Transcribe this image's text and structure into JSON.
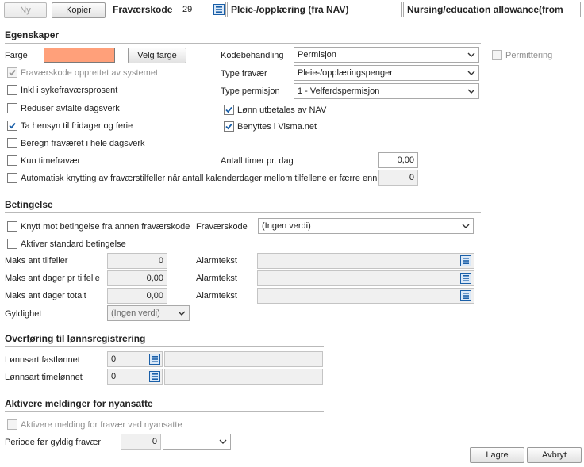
{
  "toolbar": {
    "new_label": "Ny",
    "copy_label": "Kopier",
    "code_label": "Fraværskode",
    "code_value": "29",
    "name_no": "Pleie-/opplæring (fra NAV)",
    "name_en": "Nursing/education allowance(from"
  },
  "properties": {
    "heading": "Egenskaper",
    "color_label": "Farge",
    "color_value": "#FFA07A",
    "choose_color_label": "Velg farge",
    "system_created_label": "Fraværskode opprettet av systemet",
    "incl_sick_label": "Inkl i sykefraværsprosent",
    "reduce_label": "Reduser avtalte dagsverk",
    "holidays_label": "Ta hensyn til fridager og ferie",
    "whole_day_label": "Beregn fraværet i hele dagsverk",
    "hourly_only_label": "Kun timefravær",
    "auto_link_label": "Automatisk knytting av fraværstilfeller når antall kalenderdager mellom tilfellene er færre enn",
    "auto_link_value": "0",
    "code_handling_label": "Kodebehandling",
    "code_handling_value": "Permisjon",
    "permittering_label": "Permittering",
    "absence_type_label": "Type fravær",
    "absence_type_value": "Pleie-/opplæringspenger",
    "leave_type_label": "Type permisjon",
    "leave_type_value": "1 - Velferdspermisjon",
    "nav_pay_label": "Lønn utbetales av NAV",
    "visma_label": "Benyttes i Visma.net",
    "hours_per_day_label": "Antall timer pr. dag",
    "hours_per_day_value": "0,00"
  },
  "conditions": {
    "heading": "Betingelse",
    "link_condition_label": "Knytt mot betingelse fra annen fraværskode",
    "code_label": "Fraværskode",
    "code_value": "(Ingen verdi)",
    "activate_std_label": "Aktiver standard betingelse",
    "max_cases_label": "Maks ant tilfeller",
    "max_cases_value": "0",
    "max_days_case_label": "Maks ant dager pr tilfelle",
    "max_days_case_value": "0,00",
    "max_days_total_label": "Maks ant dager totalt",
    "max_days_total_value": "0,00",
    "alarm_label": "Alarmtekst",
    "validity_label": "Gyldighet",
    "validity_value": "(Ingen verdi)"
  },
  "payroll": {
    "heading": "Overføring til lønnsregistrering",
    "fixed_label": "Lønnsart fastlønnet",
    "fixed_value": "0",
    "hourly_label": "Lønnsart timelønnet",
    "hourly_value": "0"
  },
  "newhire": {
    "heading": "Aktivere meldinger for nyansatte",
    "activate_label": "Aktivere melding for fravær ved nyansatte",
    "period_label": "Periode før gyldig fravær",
    "period_value": "0"
  },
  "footer": {
    "save_label": "Lagre",
    "cancel_label": "Avbryt"
  }
}
